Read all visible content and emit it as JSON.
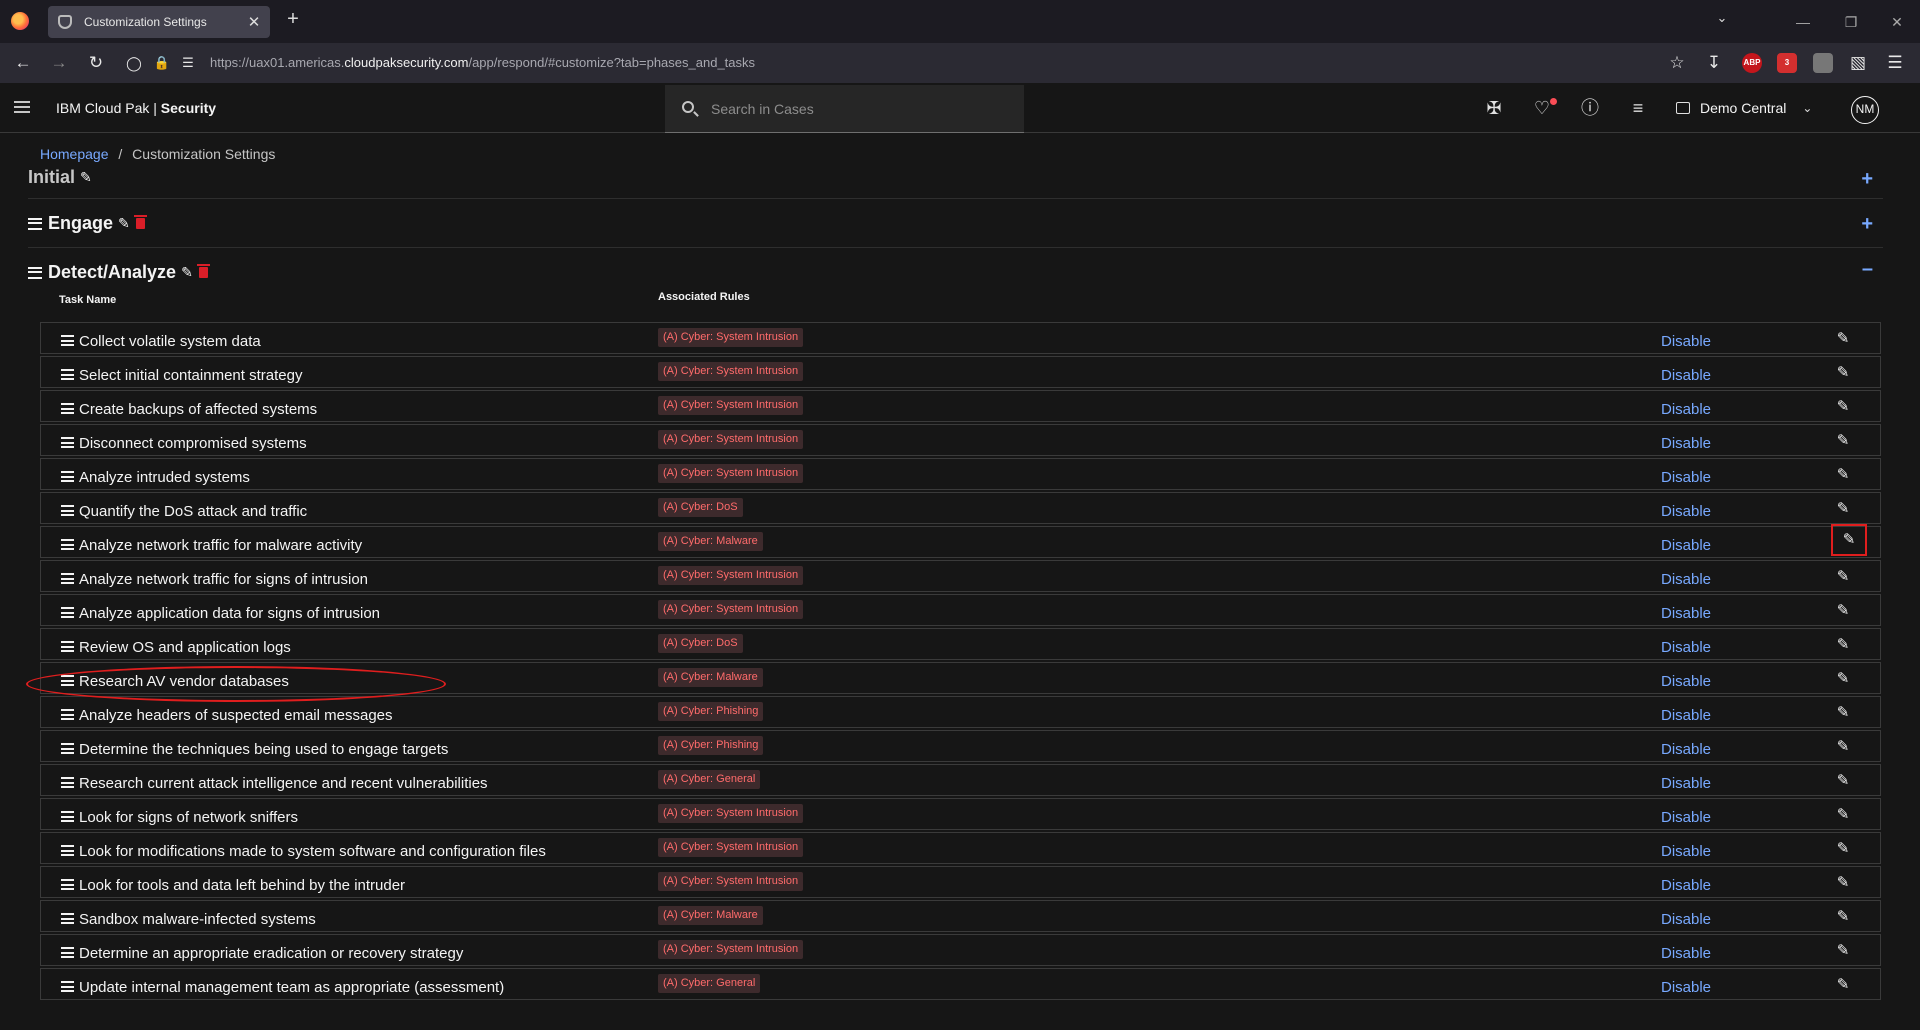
{
  "browser": {
    "tab_title": "Customization Settings",
    "new_tab_label": "+",
    "tab_close": "✕",
    "url_prefix": "https://uax01.americas.",
    "url_domain": "cloudpaksecurity.com",
    "url_path": "/app/respond/#customize?tab=phases_and_tasks",
    "extension_badge": "3",
    "abp_label": "ABP"
  },
  "app": {
    "brand_name": "IBM Cloud Pak | ",
    "brand_bold": "Security",
    "search_placeholder": "Search in Cases",
    "account_name": "Demo Central",
    "avatar_initials": "NM"
  },
  "breadcrumb": {
    "home": "Homepage",
    "separator": "/",
    "current": "Customization Settings"
  },
  "phases": [
    {
      "title": "Initial",
      "toggle": "+"
    },
    {
      "title": "Engage",
      "toggle": "+"
    },
    {
      "title": "Detect/Analyze",
      "toggle": "–"
    }
  ],
  "columns": {
    "task_name": "Task Name",
    "associated_rules": "Associated Rules"
  },
  "disable_label": "Disable",
  "tasks": [
    {
      "name": "Collect volatile system data",
      "rule": "(A) Cyber: System Intrusion"
    },
    {
      "name": "Select initial containment strategy",
      "rule": "(A) Cyber: System Intrusion"
    },
    {
      "name": "Create backups of affected systems",
      "rule": "(A) Cyber: System Intrusion"
    },
    {
      "name": "Disconnect compromised systems",
      "rule": "(A) Cyber: System Intrusion"
    },
    {
      "name": "Analyze intruded systems",
      "rule": "(A) Cyber: System Intrusion"
    },
    {
      "name": "Quantify the DoS attack and traffic",
      "rule": "(A) Cyber: DoS"
    },
    {
      "name": "Analyze network traffic for malware activity",
      "rule": "(A) Cyber: Malware"
    },
    {
      "name": "Analyze network traffic for signs of intrusion",
      "rule": "(A) Cyber: System Intrusion"
    },
    {
      "name": "Analyze application data for signs of intrusion",
      "rule": "(A) Cyber: System Intrusion"
    },
    {
      "name": "Review OS and application logs",
      "rule": "(A) Cyber: DoS"
    },
    {
      "name": "Research AV vendor databases",
      "rule": "(A) Cyber: Malware"
    },
    {
      "name": "Analyze headers of suspected email messages",
      "rule": "(A) Cyber: Phishing"
    },
    {
      "name": "Determine the techniques being used to engage targets",
      "rule": "(A) Cyber: Phishing"
    },
    {
      "name": "Research current attack intelligence and recent vulnerabilities",
      "rule": "(A) Cyber: General"
    },
    {
      "name": "Look for signs of network sniffers",
      "rule": "(A) Cyber: System Intrusion"
    },
    {
      "name": "Look for modifications made to system software and configuration files",
      "rule": "(A) Cyber: System Intrusion"
    },
    {
      "name": "Look for tools and data left behind by the intruder",
      "rule": "(A) Cyber: System Intrusion"
    },
    {
      "name": "Sandbox malware-infected systems",
      "rule": "(A) Cyber: Malware"
    },
    {
      "name": "Determine an appropriate eradication or recovery strategy",
      "rule": "(A) Cyber: System Intrusion"
    },
    {
      "name": "Update internal management team as appropriate (assessment)",
      "rule": "(A) Cyber: General"
    }
  ],
  "colors": {
    "link": "#78a9ff",
    "rule_tag_text": "#ff6b6b",
    "delete": "#da1e28",
    "annotation": "#e01e1e"
  }
}
